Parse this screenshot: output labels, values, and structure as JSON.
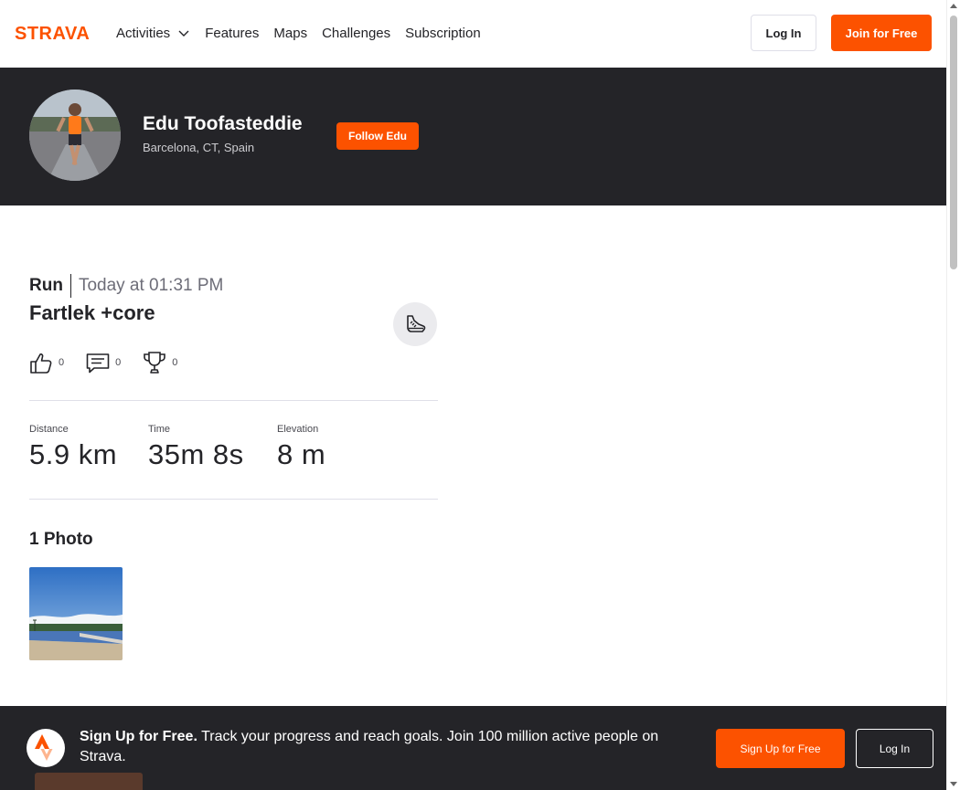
{
  "nav": {
    "logo_text": "STRAVA",
    "links": [
      {
        "label": "Activities",
        "has_dropdown": true
      },
      {
        "label": "Features",
        "has_dropdown": false
      },
      {
        "label": "Maps",
        "has_dropdown": false
      },
      {
        "label": "Challenges",
        "has_dropdown": false
      },
      {
        "label": "Subscription",
        "has_dropdown": false
      }
    ],
    "login_label": "Log In",
    "join_label": "Join for Free"
  },
  "athlete": {
    "name": "Edu Toofasteddie",
    "location": "Barcelona, CT, Spain",
    "follow_label": "Follow Edu"
  },
  "activity": {
    "type": "Run",
    "date": "Today at 01:31 PM",
    "title": "Fartlek +core",
    "sport_icon": "running-shoe-icon",
    "kudos_count": "0",
    "comments_count": "0",
    "achievements_count": "0",
    "stats": [
      {
        "label": "Distance",
        "value": "5.9 km"
      },
      {
        "label": "Time",
        "value": "35m 8s"
      },
      {
        "label": "Elevation",
        "value": "8 m"
      }
    ]
  },
  "photos": {
    "title": "1 Photo"
  },
  "signup_bar": {
    "headline": "Sign Up for Free.",
    "body": "Track your progress and reach goals. Join 100 million active people on Strava.",
    "signup_label": "Sign Up for Free",
    "login_label": "Log In"
  },
  "colors": {
    "brand": "#fc5200",
    "dark": "#242428"
  }
}
